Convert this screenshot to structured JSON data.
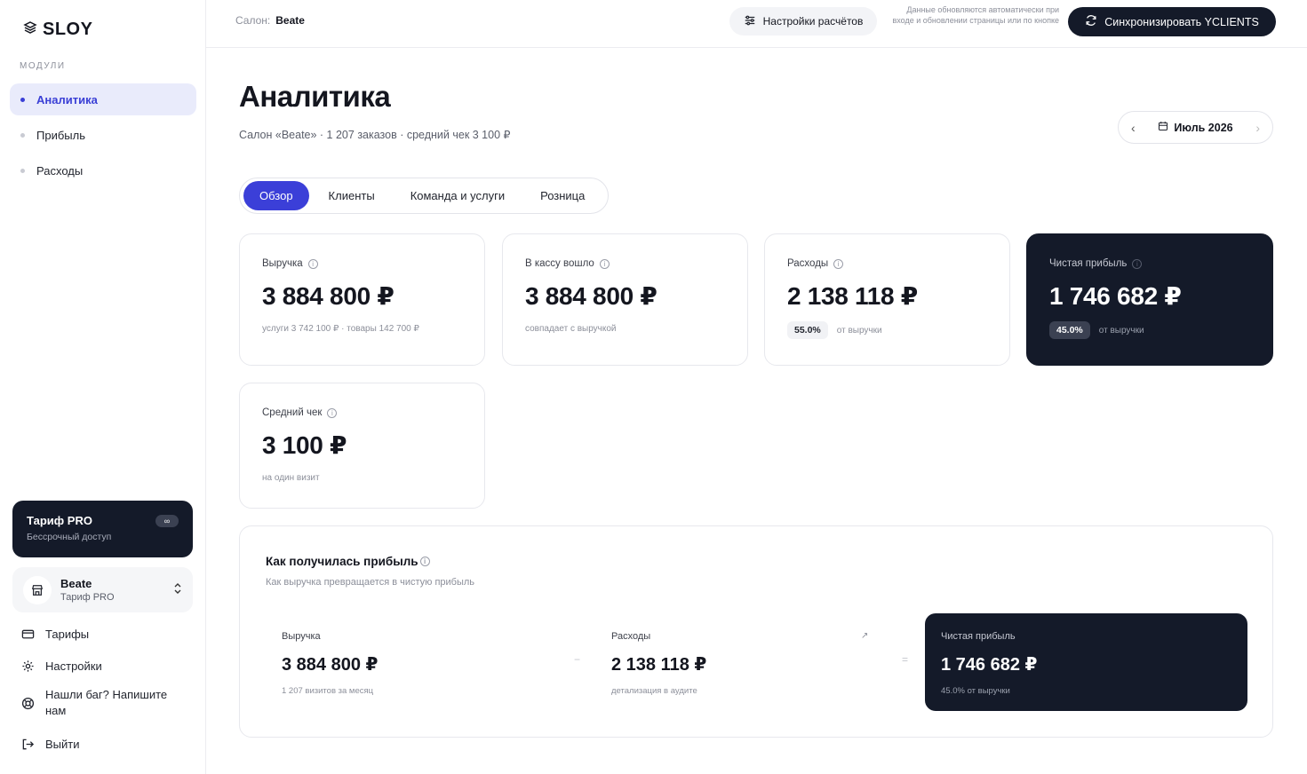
{
  "brand": {
    "name": "SLOY"
  },
  "sidebar": {
    "section_label": "МОДУЛИ",
    "items": [
      {
        "label": "Аналитика",
        "active": true
      },
      {
        "label": "Прибыль",
        "active": false
      },
      {
        "label": "Расходы",
        "active": false
      }
    ],
    "plan": {
      "title": "Тариф PRO",
      "subtitle": "Бессрочный доступ",
      "badge": "∞"
    },
    "salon": {
      "name": "Beate",
      "plan": "Тариф PRO"
    },
    "links": [
      {
        "label": "Тарифы",
        "icon": "card-icon"
      },
      {
        "label": "Настройки",
        "icon": "gear-icon"
      },
      {
        "label": "Нашли баг? Напишите нам",
        "icon": "help-icon"
      },
      {
        "label": "Выйти",
        "icon": "logout-icon"
      }
    ]
  },
  "topbar": {
    "salon_key": "Салон:",
    "salon_value": "Beate",
    "settings_label": "Настройки расчётов",
    "sync_note": "Данные обновляются автоматически при входе и обновлении страницы или по кнопке",
    "sync_label": "Синхронизировать YCLIENTS"
  },
  "page": {
    "title": "Аналитика",
    "subtitle": "Салон «Beate» · 1 207 заказов · средний чек 3 100 ₽",
    "month": "Июль 2026"
  },
  "tabs": [
    "Обзор",
    "Клиенты",
    "Команда и услуги",
    "Розница"
  ],
  "cards": {
    "revenue": {
      "label": "Выручка",
      "value": "3 884 800 ₽",
      "note": "услуги 3 742 100 ₽ · товары 142 700 ₽"
    },
    "cash": {
      "label": "В кассу вошло",
      "value": "3 884 800 ₽",
      "note": "совпадает с выручкой"
    },
    "expenses": {
      "label": "Расходы",
      "value": "2 138 118 ₽",
      "pct": "55.0%",
      "note": "от выручки"
    },
    "profit": {
      "label": "Чистая прибыль",
      "value": "1 746 682 ₽",
      "pct": "45.0%",
      "note": "от выручки"
    },
    "avg_check": {
      "label": "Средний чек",
      "value": "3 100 ₽",
      "note": "на один визит"
    }
  },
  "profit_panel": {
    "title": "Как получилась прибыль",
    "subtitle": "Как выручка превращается в чистую прибыль",
    "revenue": {
      "label": "Выручка",
      "value": "3 884 800 ₽",
      "note": "1 207 визитов за месяц"
    },
    "minus": "−",
    "expenses": {
      "label": "Расходы",
      "value": "2 138 118 ₽",
      "note": "детализация в аудите"
    },
    "equals": "=",
    "profit": {
      "label": "Чистая прибыль",
      "value": "1 746 682 ₽",
      "note": "45.0% от выручки"
    }
  }
}
